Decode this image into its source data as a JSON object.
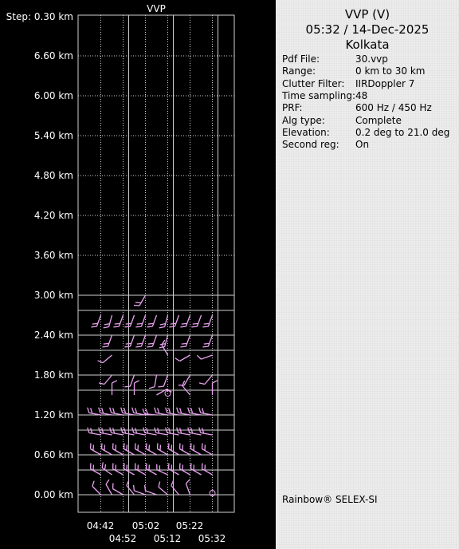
{
  "chart_title": "VVP",
  "info": {
    "title": "VVP (V)",
    "datetime": "05:32 / 14-Dec-2025",
    "location": "Kolkata",
    "rows": [
      {
        "key": "Pdf File:",
        "value": "30.vvp"
      },
      {
        "key": "Range:",
        "value": "0 km to 30 km"
      },
      {
        "key": "Clutter Filter:",
        "value": "IIRDoppler 7"
      },
      {
        "key": "Time sampling:",
        "value": "48"
      },
      {
        "key": "PRF:",
        "value": "600 Hz / 450 Hz"
      },
      {
        "key": "Alg type:",
        "value": "Complete"
      },
      {
        "key": "Elevation:",
        "value": "0.2 deg to 21.0 deg"
      },
      {
        "key": "Second reg:",
        "value": "On"
      }
    ],
    "footer": "Rainbow® SELEX-SI"
  },
  "colors": {
    "grid": "#d0d0d0",
    "barb": "#e8a2ee",
    "background": "#000000",
    "text": "#ffffff"
  },
  "chart_data": {
    "type": "wind-barb-profile",
    "title": "VVP",
    "step_label": "Step: 0.30 km",
    "y_unit": "km",
    "ylim": [
      0.0,
      7.2
    ],
    "y_ticks": [
      0.0,
      0.6,
      1.2,
      1.8,
      2.4,
      3.0,
      3.6,
      4.2,
      4.8,
      5.4,
      6.0,
      6.6
    ],
    "y_tick_labels": [
      "0.00 km",
      "0.60 km",
      "1.20 km",
      "1.80 km",
      "2.40 km",
      "3.00 km",
      "3.60 km",
      "4.20 km",
      "4.80 km",
      "5.40 km",
      "6.00 km",
      "6.60 km"
    ],
    "x_times": [
      "04:42",
      "04:47",
      "04:52",
      "04:57",
      "05:02",
      "05:07",
      "05:12",
      "05:17",
      "05:22",
      "05:27",
      "05:32"
    ],
    "x_tick_labels_row1": [
      "04:42",
      "05:02",
      "05:22"
    ],
    "x_tick_labels_row2": [
      "04:52",
      "05:12",
      "05:32"
    ],
    "barbs": [
      {
        "time": "04:42",
        "alt": 0.0,
        "dir": 315,
        "barbs": 1
      },
      {
        "time": "04:47",
        "alt": 0.0,
        "dir": 330,
        "barbs": 1
      },
      {
        "time": "04:52",
        "alt": 0.0,
        "dir": 300,
        "barbs": 1
      },
      {
        "time": "04:57",
        "alt": 0.0,
        "dir": 320,
        "barbs": 1
      },
      {
        "time": "05:02",
        "alt": 0.0,
        "dir": 290,
        "barbs": 1
      },
      {
        "time": "05:07",
        "alt": 0.0,
        "dir": 290,
        "barbs": 1
      },
      {
        "time": "05:12",
        "alt": 0.0,
        "dir": 310,
        "barbs": 1
      },
      {
        "time": "05:17",
        "alt": 0.0,
        "dir": 320,
        "barbs": 1
      },
      {
        "time": "05:22",
        "alt": 0.0,
        "dir": 340,
        "barbs": 1
      },
      {
        "time": "05:32",
        "alt": 0.0,
        "calm": true
      },
      {
        "time": "04:42",
        "alt": 0.3,
        "dir": 300,
        "barbs": 2
      },
      {
        "time": "04:47",
        "alt": 0.3,
        "dir": 305,
        "barbs": 2
      },
      {
        "time": "04:52",
        "alt": 0.3,
        "dir": 300,
        "barbs": 2
      },
      {
        "time": "04:57",
        "alt": 0.3,
        "dir": 300,
        "barbs": 2
      },
      {
        "time": "05:02",
        "alt": 0.3,
        "dir": 300,
        "barbs": 2
      },
      {
        "time": "05:07",
        "alt": 0.3,
        "dir": 300,
        "barbs": 2
      },
      {
        "time": "05:12",
        "alt": 0.3,
        "dir": 295,
        "barbs": 2
      },
      {
        "time": "05:17",
        "alt": 0.3,
        "dir": 300,
        "barbs": 2
      },
      {
        "time": "05:22",
        "alt": 0.3,
        "dir": 300,
        "barbs": 2
      },
      {
        "time": "05:27",
        "alt": 0.3,
        "dir": 300,
        "barbs": 2
      },
      {
        "time": "05:32",
        "alt": 0.3,
        "dir": 300,
        "barbs": 2
      },
      {
        "time": "04:42",
        "alt": 0.6,
        "dir": 300,
        "barbs": 2
      },
      {
        "time": "04:47",
        "alt": 0.6,
        "dir": 300,
        "barbs": 2
      },
      {
        "time": "04:52",
        "alt": 0.6,
        "dir": 300,
        "barbs": 2
      },
      {
        "time": "04:57",
        "alt": 0.6,
        "dir": 300,
        "barbs": 2
      },
      {
        "time": "05:02",
        "alt": 0.6,
        "dir": 300,
        "barbs": 2
      },
      {
        "time": "05:07",
        "alt": 0.6,
        "dir": 300,
        "barbs": 2
      },
      {
        "time": "05:12",
        "alt": 0.6,
        "dir": 300,
        "barbs": 2
      },
      {
        "time": "05:17",
        "alt": 0.6,
        "dir": 300,
        "barbs": 2
      },
      {
        "time": "05:22",
        "alt": 0.6,
        "dir": 300,
        "barbs": 2
      },
      {
        "time": "05:27",
        "alt": 0.6,
        "dir": 300,
        "barbs": 2
      },
      {
        "time": "05:32",
        "alt": 0.6,
        "dir": 300,
        "barbs": 2
      },
      {
        "time": "04:42",
        "alt": 0.9,
        "dir": 280,
        "barbs": 2
      },
      {
        "time": "04:47",
        "alt": 0.9,
        "dir": 280,
        "barbs": 2
      },
      {
        "time": "04:52",
        "alt": 0.9,
        "dir": 280,
        "barbs": 2
      },
      {
        "time": "04:57",
        "alt": 0.9,
        "dir": 280,
        "barbs": 2
      },
      {
        "time": "05:02",
        "alt": 0.9,
        "dir": 280,
        "barbs": 2
      },
      {
        "time": "05:07",
        "alt": 0.9,
        "dir": 280,
        "barbs": 2
      },
      {
        "time": "05:12",
        "alt": 0.9,
        "dir": 280,
        "barbs": 2
      },
      {
        "time": "05:17",
        "alt": 0.9,
        "dir": 280,
        "barbs": 2
      },
      {
        "time": "05:22",
        "alt": 0.9,
        "dir": 280,
        "barbs": 2
      },
      {
        "time": "05:27",
        "alt": 0.9,
        "dir": 280,
        "barbs": 2
      },
      {
        "time": "05:32",
        "alt": 0.9,
        "dir": 280,
        "barbs": 2
      },
      {
        "time": "04:42",
        "alt": 1.2,
        "dir": 280,
        "barbs": 2
      },
      {
        "time": "04:47",
        "alt": 1.2,
        "dir": 280,
        "barbs": 2
      },
      {
        "time": "04:52",
        "alt": 1.2,
        "dir": 280,
        "barbs": 2
      },
      {
        "time": "04:57",
        "alt": 1.2,
        "dir": 280,
        "barbs": 2
      },
      {
        "time": "05:02",
        "alt": 1.2,
        "dir": 280,
        "barbs": 2
      },
      {
        "time": "05:07",
        "alt": 1.2,
        "dir": 275,
        "barbs": 2
      },
      {
        "time": "05:12",
        "alt": 1.2,
        "dir": 280,
        "barbs": 2
      },
      {
        "time": "05:17",
        "alt": 1.2,
        "dir": 280,
        "barbs": 2
      },
      {
        "time": "05:22",
        "alt": 1.2,
        "dir": 280,
        "barbs": 2
      },
      {
        "time": "05:27",
        "alt": 1.2,
        "dir": 280,
        "barbs": 2
      },
      {
        "time": "05:32",
        "alt": 1.2,
        "dir": 280,
        "barbs": 2
      },
      {
        "time": "04:47",
        "alt": 1.5,
        "dir": 0,
        "barbs": 1
      },
      {
        "time": "04:57",
        "alt": 1.5,
        "dir": 0,
        "barbs": 1
      },
      {
        "time": "05:07",
        "alt": 1.5,
        "dir": 60,
        "barbs": 1
      },
      {
        "time": "05:12",
        "alt": 1.5,
        "calm": true
      },
      {
        "time": "05:22",
        "alt": 1.5,
        "dir": 320,
        "barbs": 1
      },
      {
        "time": "05:32",
        "alt": 1.5,
        "dir": 0,
        "barbs": 1
      },
      {
        "time": "04:47",
        "alt": 1.8,
        "dir": 220,
        "barbs": 1
      },
      {
        "time": "04:57",
        "alt": 1.8,
        "dir": 200,
        "barbs": 1
      },
      {
        "time": "05:07",
        "alt": 1.8,
        "dir": 190,
        "barbs": 1
      },
      {
        "time": "05:12",
        "alt": 1.8,
        "dir": 200,
        "barbs": 1
      },
      {
        "time": "05:22",
        "alt": 1.8,
        "dir": 210,
        "barbs": 1
      },
      {
        "time": "05:32",
        "alt": 1.8,
        "dir": 220,
        "barbs": 1
      },
      {
        "time": "04:47",
        "alt": 2.1,
        "dir": 230,
        "barbs": 1
      },
      {
        "time": "05:12",
        "alt": 2.1,
        "dir": 330,
        "barbs": 1
      },
      {
        "time": "05:22",
        "alt": 2.1,
        "dir": 240,
        "barbs": 1
      },
      {
        "time": "05:32",
        "alt": 2.1,
        "dir": 250,
        "barbs": 1
      },
      {
        "time": "04:47",
        "alt": 2.4,
        "dir": 200,
        "barbs": 2
      },
      {
        "time": "04:57",
        "alt": 2.4,
        "dir": 200,
        "barbs": 2
      },
      {
        "time": "05:02",
        "alt": 2.4,
        "dir": 200,
        "barbs": 2
      },
      {
        "time": "05:07",
        "alt": 2.4,
        "dir": 200,
        "barbs": 2
      },
      {
        "time": "05:12",
        "alt": 2.4,
        "dir": 195,
        "barbs": 2
      },
      {
        "time": "05:22",
        "alt": 2.4,
        "dir": 200,
        "barbs": 2
      },
      {
        "time": "05:32",
        "alt": 2.4,
        "dir": 200,
        "barbs": 2
      },
      {
        "time": "04:42",
        "alt": 2.7,
        "dir": 200,
        "barbs": 2
      },
      {
        "time": "04:47",
        "alt": 2.7,
        "dir": 195,
        "barbs": 2
      },
      {
        "time": "04:52",
        "alt": 2.7,
        "dir": 200,
        "barbs": 2
      },
      {
        "time": "04:57",
        "alt": 2.7,
        "dir": 200,
        "barbs": 2
      },
      {
        "time": "05:02",
        "alt": 2.7,
        "dir": 200,
        "barbs": 2
      },
      {
        "time": "05:07",
        "alt": 2.7,
        "dir": 200,
        "barbs": 2
      },
      {
        "time": "05:12",
        "alt": 2.7,
        "dir": 195,
        "barbs": 2
      },
      {
        "time": "05:17",
        "alt": 2.7,
        "dir": 200,
        "barbs": 2
      },
      {
        "time": "05:22",
        "alt": 2.7,
        "dir": 200,
        "barbs": 2
      },
      {
        "time": "05:27",
        "alt": 2.7,
        "dir": 200,
        "barbs": 2
      },
      {
        "time": "05:32",
        "alt": 2.7,
        "dir": 200,
        "barbs": 2
      },
      {
        "time": "05:02",
        "alt": 3.0,
        "dir": 210,
        "barbs": 2
      }
    ]
  }
}
